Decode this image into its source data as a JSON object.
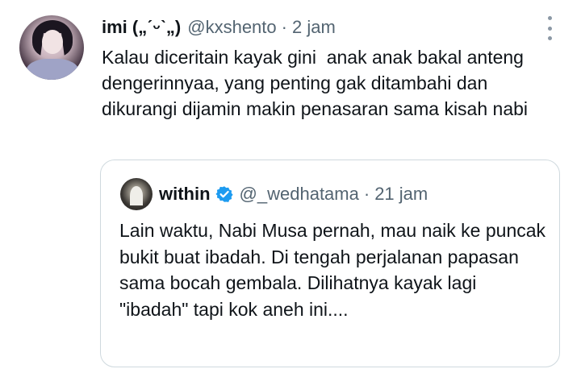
{
  "tweet": {
    "author_name": "imi („ˊᵕˋ„)",
    "author_handle": "@kxshento",
    "separator": "·",
    "time": "2 jam",
    "text": "Kalau diceritain kayak gini  anak anak bakal anteng dengerinnyaa, yang penting gak ditambahi dan dikurangi dijamin makin penasaran sama kisah nabi"
  },
  "quoted_tweet": {
    "author_name": "within",
    "author_handle": "@_wedhatama",
    "separator": "·",
    "time": "21 jam",
    "text": "Lain waktu, Nabi Musa pernah, mau naik ke puncak bukit buat ibadah. Di tengah perjalanan papasan sama bocah gembala. Dilihatnya kayak lagi \"ibadah\" tapi kok aneh ini....",
    "verified": true
  },
  "icons": {
    "more": "more-vertical-icon",
    "verified": "verified-badge-icon"
  },
  "colors": {
    "text_primary": "#0f1419",
    "text_secondary": "#536471",
    "border": "#cfd9de",
    "verified_blue": "#1d9bf0"
  }
}
